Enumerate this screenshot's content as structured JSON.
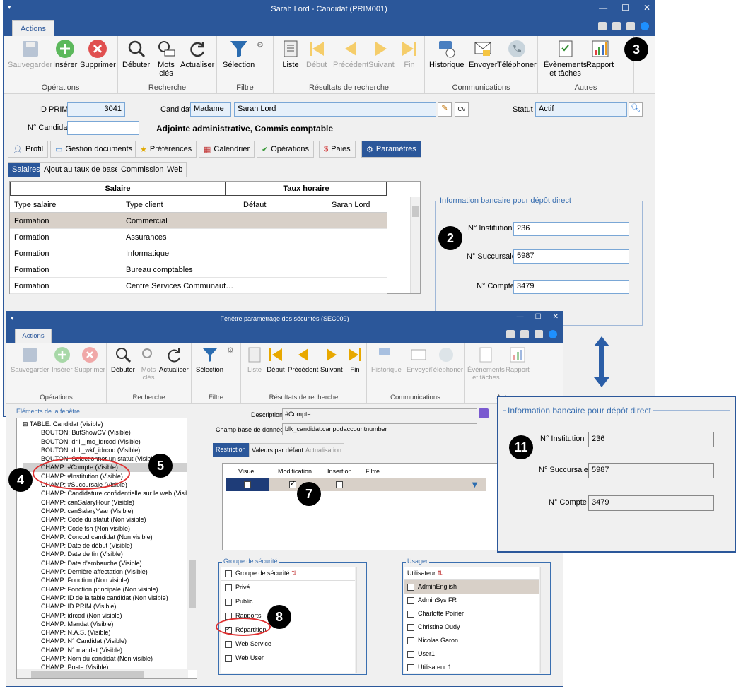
{
  "main": {
    "title": "Sarah Lord - Candidat (PRIM001)",
    "tab": "Actions",
    "groups": {
      "operations": "Opérations",
      "recherche": "Recherche",
      "filtre": "Filtre",
      "resultats": "Résultats de recherche",
      "communications": "Communications",
      "autres": "Autres"
    },
    "buttons": {
      "save": "Sauvegarder",
      "insert": "Insérer",
      "delete": "Supprimer",
      "debuter": "Débuter",
      "mots": "Mots",
      "cles": "clés",
      "actualiser": "Actualiser",
      "selection": "Sélection",
      "liste": "Liste",
      "debut": "Début",
      "precedent": "Précédent",
      "suivant": "Suivant",
      "fin": "Fin",
      "historique": "Historique",
      "envoyer": "Envoyer",
      "telephoner": "Téléphoner",
      "evenements": "Évènements",
      "taches": "et tâches",
      "rapport": "Rapport"
    },
    "form": {
      "id_label": "ID PRIM",
      "id_value": "3041",
      "candidat_label": "Candidat",
      "civilite": "Madame",
      "name": "Sarah Lord",
      "statut_label": "Statut",
      "statut": "Actif",
      "no_label": "N° Candidat",
      "no_value": "",
      "poste": "Adjointe administrative, Commis comptable"
    },
    "tabs": [
      "Profil",
      "Gestion documents",
      "Préférences",
      "Calendrier",
      "Opérations",
      "Paies",
      "Paramètres"
    ],
    "subtabs": [
      "Salaires",
      "Ajout au taux de base",
      "Commissions",
      "Web"
    ],
    "grid": {
      "h_salaire": "Salaire",
      "h_taux": "Taux horaire",
      "c1": "Type salaire",
      "c2": "Type client",
      "c3": "Défaut",
      "c4": "Sarah Lord",
      "rows": [
        [
          "Formation",
          "Commercial"
        ],
        [
          "Formation",
          "Assurances"
        ],
        [
          "Formation",
          "Informatique"
        ],
        [
          "Formation",
          "Bureau comptables"
        ],
        [
          "Formation",
          "Centre Services Communaut…"
        ]
      ]
    },
    "bank": {
      "title": "Information bancaire pour dépôt direct",
      "inst_label": "N° Institution",
      "inst": "236",
      "succ_label": "N° Succursale",
      "succ": "5987",
      "compte_label": "N° Compte",
      "compte": "3479"
    }
  },
  "sec": {
    "title": "Fenêtre paramétrage des sécurités (SEC009)",
    "tab": "Actions",
    "tree_title": "Éléments de la fenêtre",
    "tree": [
      "TABLE: Candidat (Visible)",
      "BOUTON: ButShowCV (Visible)",
      "BOUTON: drill_imc_idrcod (Visible)",
      "BOUTON: drill_wkf_idrcod (Visible)",
      "BOUTON: Sélectionner un statut (Visible)",
      "CHAMP: #Compte (Visible)",
      "CHAMP: #Institution (Visible)",
      "CHAMP: #Succursale (Visible)",
      "CHAMP: Candidature confidentielle sur le web (Visible)",
      "CHAMP: canSalaryHour (Visible)",
      "CHAMP: canSalaryYear (Visible)",
      "CHAMP: Code du statut (Non visible)",
      "CHAMP: Code fsh (Non visible)",
      "CHAMP: Concod candidat (Non visible)",
      "CHAMP: Date de début (Visible)",
      "CHAMP: Date de fin (Visible)",
      "CHAMP: Date d'embauche (Visible)",
      "CHAMP: Dernière affectation (Visible)",
      "CHAMP: Fonction (Non visible)",
      "CHAMP: Fonction principale (Non visible)",
      "CHAMP: ID de la table candidat (Non visible)",
      "CHAMP: ID PRIM (Visible)",
      "CHAMP: idrcod (Non visible)",
      "CHAMP: Mandat (Visible)",
      "CHAMP: N.A.S. (Visible)",
      "CHAMP: N° Candidat (Visible)",
      "CHAMP: N° mandat (Visible)",
      "CHAMP: Nom du candidat (Non visible)",
      "CHAMP: Poste (Visible)"
    ],
    "desc_label": "Description",
    "desc": "#Compte",
    "champ_label": "Champ base de données",
    "champ": "blk_candidat.canpddaccountnumber",
    "tabs": [
      "Restriction",
      "Valeurs par défaut",
      "Actualisation"
    ],
    "cols": [
      "Visuel",
      "Modification",
      "Insertion",
      "Filtre"
    ],
    "groupe_title": "Groupe de sécurité",
    "groupes": [
      "Groupe de sécurité",
      "Privé",
      "Public",
      "Rapports",
      "Répartition",
      "Web Service",
      "Web User"
    ],
    "usager_title": "Usager",
    "usagers": [
      "Utilisateur",
      "AdminEnglish",
      "AdminSys FR",
      "Charlotte Poirier",
      "Christine Oudy",
      "Nicolas Garon",
      "User1",
      "Utilisateur 1"
    ]
  },
  "overlay": {
    "title": "Information bancaire pour dépôt direct",
    "inst_label": "N° Institution",
    "inst": "236",
    "succ_label": "N° Succursale",
    "succ": "5987",
    "compte_label": "N° Compte",
    "compte": "3479"
  },
  "callouts": [
    "2",
    "3",
    "4",
    "5",
    "7",
    "8",
    "11"
  ]
}
